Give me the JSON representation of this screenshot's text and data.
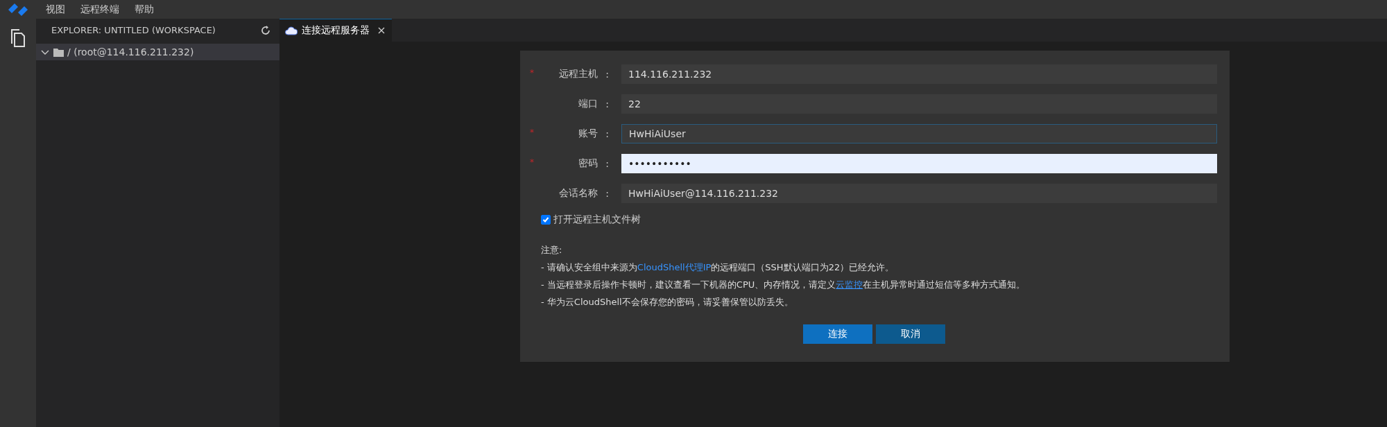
{
  "menu_bar": {
    "items": [
      "视图",
      "远程终端",
      "帮助"
    ]
  },
  "sidebar": {
    "title": "EXPLORER: UNTITLED (WORKSPACE)",
    "tree": [
      {
        "label": "/ (root@114.116.211.232)",
        "expanded": true,
        "selected": true
      }
    ]
  },
  "tabs": [
    {
      "label": "连接远程服务器",
      "selected": true
    }
  ],
  "form": {
    "fields": [
      {
        "required_mark": "*",
        "label": "远程主机",
        "colon": ":",
        "value": "114.116.211.232",
        "focused": false,
        "autofilled": false
      },
      {
        "label": "端口",
        "colon": ":",
        "value": "22",
        "focused": false,
        "autofilled": false
      },
      {
        "required_mark": "*",
        "label": "账号",
        "colon": ":",
        "value": "HwHiAiUser",
        "focused": true,
        "autofilled": false
      },
      {
        "required_mark": "*",
        "label": "密码",
        "colon": ":",
        "value": "•••••••••••",
        "focused": false,
        "autofilled": true
      },
      {
        "label": "会话名称",
        "colon": ":",
        "value": "HwHiAiUser@114.116.211.232",
        "focused": false,
        "autofilled": false
      }
    ],
    "checkbox": {
      "label": "打开远程主机文件树",
      "checked": true
    },
    "notes_title": "注意:",
    "notes": [
      {
        "parts": [
          {
            "kind": "text",
            "text": "- 请确认安全组中来源为"
          },
          {
            "kind": "highlight",
            "text": "CloudShell代理IP"
          },
          {
            "kind": "text",
            "text": "的远程端口（SSH默认端口为22）已经允许。"
          }
        ]
      },
      {
        "parts": [
          {
            "kind": "text",
            "text": "- 当远程登录后操作卡顿时，建议查看一下机器的CPU、内存情况，请定义"
          },
          {
            "kind": "link",
            "text": "云监控"
          },
          {
            "kind": "text",
            "text": "在主机异常时通过短信等多种方式通知。"
          }
        ]
      },
      {
        "parts": [
          {
            "kind": "text",
            "text": "- 华为云CloudShell不会保存您的密码，请妥善保管以防丢失。"
          }
        ]
      }
    ],
    "buttons": [
      {
        "label": "连接",
        "kind": "primary"
      },
      {
        "label": "取消",
        "kind": "secondary"
      }
    ]
  }
}
